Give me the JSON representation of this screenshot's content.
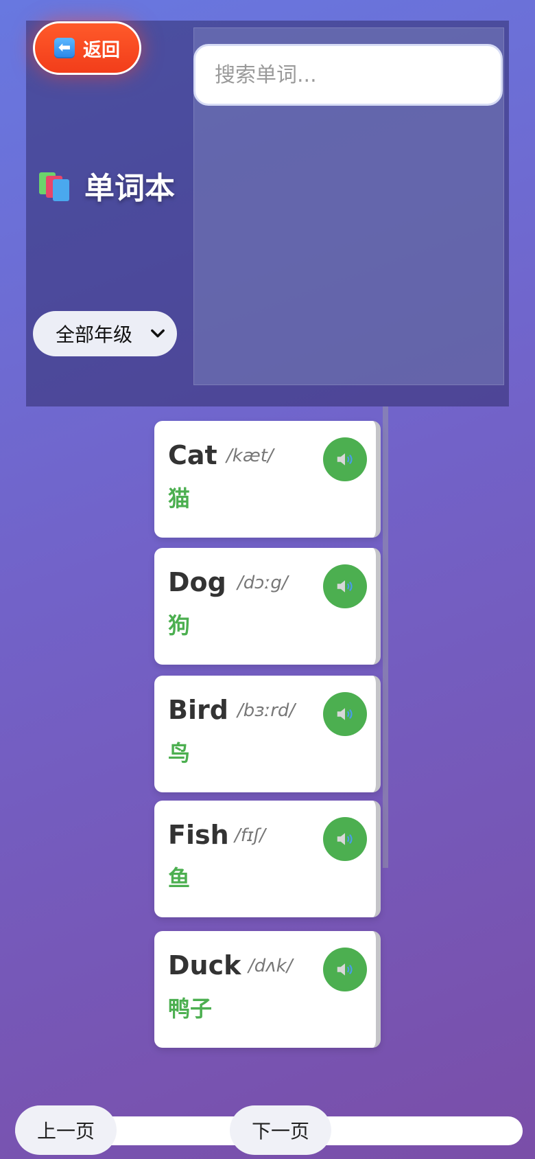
{
  "header": {
    "back_label": "返回",
    "back_icon": "left-arrow-icon",
    "title": "单词本",
    "title_icon": "books-icon",
    "search_placeholder": "搜索单词...",
    "grade_filter": {
      "selected": "全部年级"
    }
  },
  "words": [
    {
      "word": "Cat",
      "phonetic": "/kæt/",
      "meaning": "猫"
    },
    {
      "word": "Dog",
      "phonetic": "/dɔːg/",
      "meaning": "狗"
    },
    {
      "word": "Bird",
      "phonetic": "/bɜːrd/",
      "meaning": "鸟"
    },
    {
      "word": "Fish",
      "phonetic": "/fɪʃ/",
      "meaning": "鱼"
    },
    {
      "word": "Duck",
      "phonetic": "/dʌk/",
      "meaning": "鸭子"
    }
  ],
  "pagination": {
    "prev_label": "上一页",
    "next_label": "下一页"
  },
  "colors": {
    "accent_green": "#4caf50",
    "back_button": "#f23d1a"
  }
}
